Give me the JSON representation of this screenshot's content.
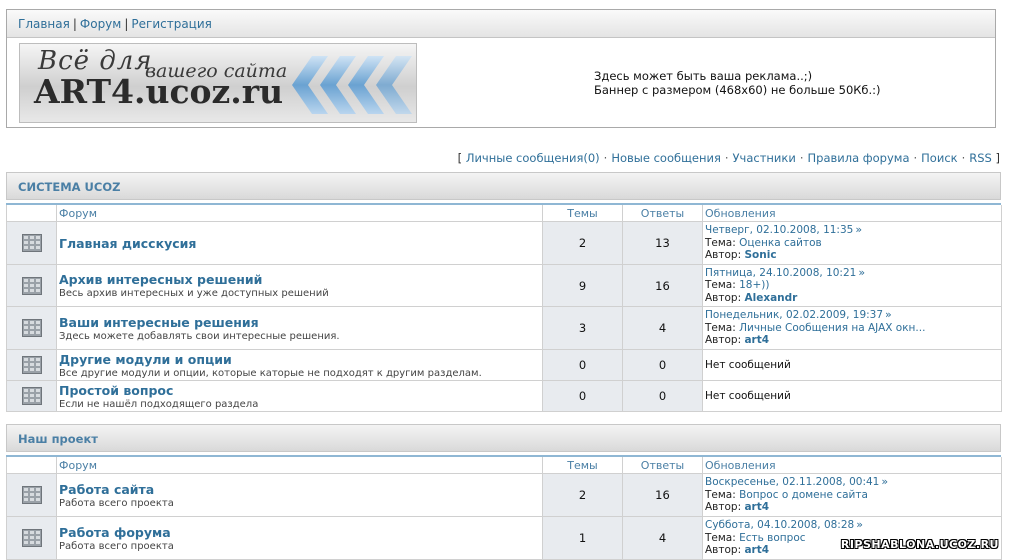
{
  "nav": {
    "home": "Главная",
    "forum": "Форум",
    "register": "Регистрация"
  },
  "logo": {
    "line1": "Всё для",
    "line2": "вашего сайта",
    "line3": "ART4.ucoz.ru"
  },
  "ad": {
    "line1": "Здесь может быть ваша реклама..;)",
    "line2": "Баннер с размером (468x60) не больше 50Кб.:)"
  },
  "userlinks": {
    "open": "[",
    "close": "]",
    "items": [
      "Личные сообщения(0)",
      "Новые сообщения",
      "Участники",
      "Правила форума",
      "Поиск",
      "RSS"
    ]
  },
  "headers": {
    "forum": "Форум",
    "topics": "Темы",
    "replies": "Ответы",
    "updates": "Обновления"
  },
  "labels": {
    "topic": "Тема:",
    "author": "Автор:",
    "no_messages": "Нет сообщений"
  },
  "categories": [
    {
      "title": "СИСТЕМА UCOZ",
      "forums": [
        {
          "name": "Главная дисскусия",
          "desc": "",
          "topics": "2",
          "replies": "13",
          "date": "Четверг, 02.10.2008, 11:35",
          "thread": "Оценка сайтов",
          "author": "Sonic"
        },
        {
          "name": "Архив интересных решений",
          "desc": "Весь архив интересных и уже доступных решений",
          "topics": "9",
          "replies": "16",
          "date": "Пятница, 24.10.2008, 10:21",
          "thread": "18+))",
          "author": "Alexandr"
        },
        {
          "name": "Ваши интересные решения",
          "desc": "Здесь можете добавлять свои интересные решения.",
          "topics": "3",
          "replies": "4",
          "date": "Понедельник, 02.02.2009, 19:37",
          "thread": "Личные Сообщения на AJAX окн...",
          "author": "art4"
        },
        {
          "name": "Другие модули и опции",
          "desc": "Все другие модули и опции, которые каторые не подходят к другим разделам.",
          "topics": "0",
          "replies": "0",
          "date": "",
          "thread": "",
          "author": ""
        },
        {
          "name": "Простой вопрос",
          "desc": "Если не нашёл подходящего раздела",
          "topics": "0",
          "replies": "0",
          "date": "",
          "thread": "",
          "author": ""
        }
      ]
    },
    {
      "title": "Наш проект",
      "forums": [
        {
          "name": "Работа сайта",
          "desc": "Работа всего проекта",
          "topics": "2",
          "replies": "16",
          "date": "Воскресенье, 02.11.2008, 00:41",
          "thread": "Вопрос о домене сайта",
          "author": "art4"
        },
        {
          "name": "Работа форума",
          "desc": "Работа всего проекта",
          "topics": "1",
          "replies": "4",
          "date": "Суббота, 04.10.2008, 08:28",
          "thread": "Есть вопрос",
          "author": "art4"
        }
      ]
    }
  ],
  "watermark": "RIPSHABLONA.UCOZ.RU",
  "colors": {
    "link": "#2f6f99",
    "category_title": "#4a7fa5",
    "cell_shade": "#e8ebef",
    "accent_line": "#8fb7d4"
  }
}
